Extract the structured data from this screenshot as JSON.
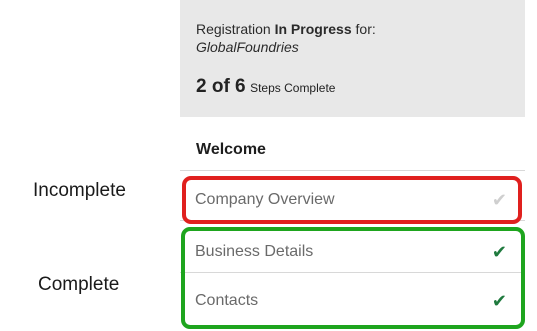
{
  "header": {
    "registration_prefix": "Registration",
    "status": "In Progress",
    "registration_suffix": "for:",
    "company": "GlobalFoundries",
    "steps_count": "2 of 6",
    "steps_label": "Steps Complete"
  },
  "nav": {
    "welcome": "Welcome",
    "items": [
      {
        "label": "Company Overview",
        "status": "incomplete",
        "check_icon": "check-icon",
        "check_color": "#cfcfcf"
      },
      {
        "label": "Business Details",
        "status": "complete",
        "check_icon": "check-icon",
        "check_color": "#1f7a3e"
      },
      {
        "label": "Contacts",
        "status": "complete",
        "check_icon": "check-icon",
        "check_color": "#1f7a3e"
      }
    ]
  },
  "annotations": {
    "incomplete": "Incomplete",
    "complete": "Complete",
    "incomplete_color": "#e0201e",
    "complete_color": "#1ea51e"
  }
}
